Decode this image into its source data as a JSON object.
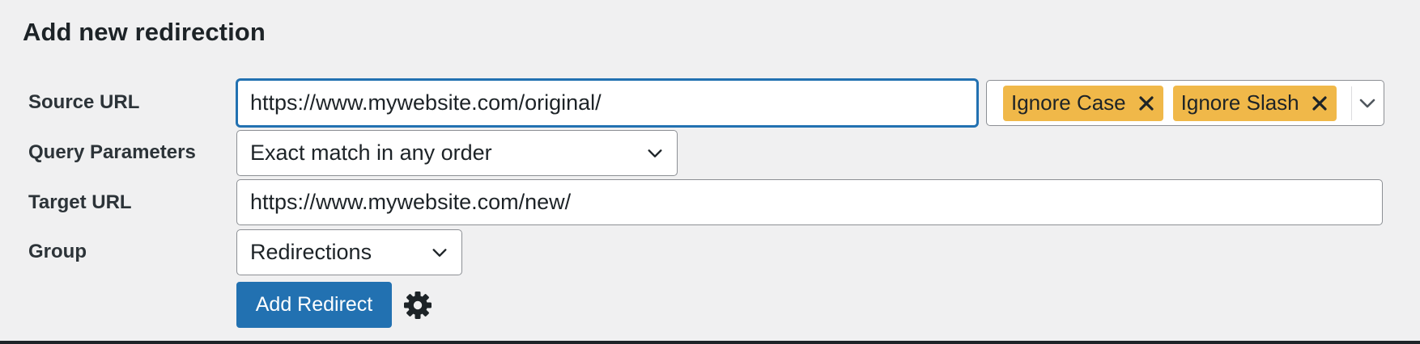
{
  "title": "Add new redirection",
  "source": {
    "label": "Source URL",
    "value": "https://www.mywebsite.com/original/",
    "flags": [
      "Ignore Case",
      "Ignore Slash"
    ]
  },
  "query": {
    "label": "Query Parameters",
    "selected": "Exact match in any order"
  },
  "target": {
    "label": "Target URL",
    "value": "https://www.mywebsite.com/new/"
  },
  "group": {
    "label": "Group",
    "selected": "Redirections"
  },
  "actions": {
    "add_label": "Add Redirect",
    "settings_icon": "gear-icon"
  },
  "colors": {
    "background": "#f0f0f1",
    "primary": "#2271b1",
    "tag": "#f0b849",
    "border": "#8c8f94"
  }
}
